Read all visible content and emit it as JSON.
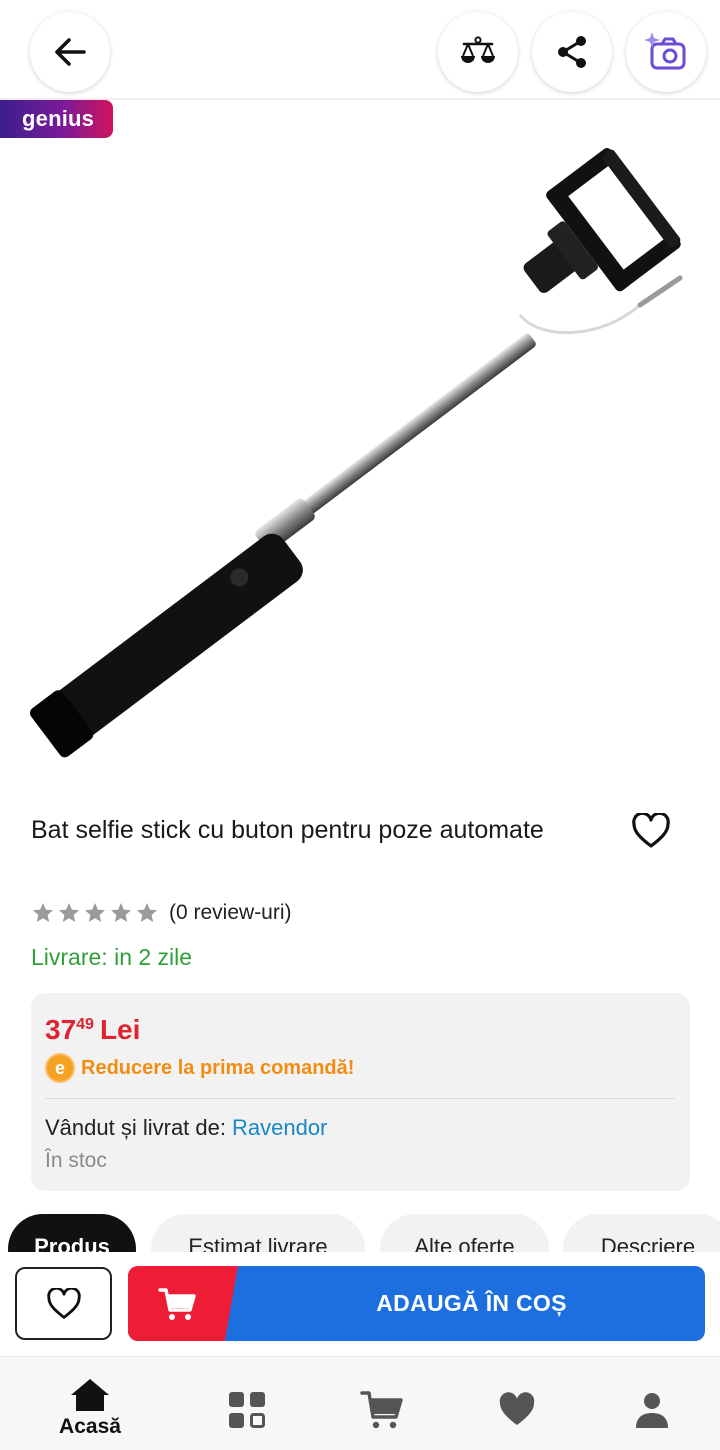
{
  "header": {
    "back_icon": "arrow-left-icon",
    "compare_icon": "scale-icon",
    "share_icon": "share-icon",
    "visual_search_icon": "camera-sparkle-icon"
  },
  "badge": {
    "label": "genius"
  },
  "product": {
    "title": "Bat selfie stick cu buton pentru poze automate",
    "rating": 0,
    "review_count_label": "(0 review-uri)",
    "delivery_label": "Livrare: in 2 zile"
  },
  "price": {
    "integer": "37",
    "decimal": "49",
    "currency": "Lei",
    "promo_icon_letter": "e",
    "promo_label": "Reducere la prima comandă!",
    "seller_prefix": "Vândut și livrat de:",
    "seller_name": "Ravendor",
    "stock_label": "În stoc"
  },
  "tabs": [
    {
      "label": "Produs",
      "active": true
    },
    {
      "label": "Estimat livrare",
      "active": false
    },
    {
      "label": "Alte oferte",
      "active": false
    },
    {
      "label": "Descriere",
      "active": false
    }
  ],
  "actions": {
    "add_to_cart_label": "ADAUGĂ ÎN COȘ",
    "wishlist_icon": "heart-outline-icon",
    "cart_icon": "cart-icon"
  },
  "nav": [
    {
      "label": "Acasă",
      "icon": "home-icon",
      "active": true
    },
    {
      "label": "",
      "icon": "categories-icon",
      "active": false
    },
    {
      "label": "",
      "icon": "cart-icon",
      "active": false
    },
    {
      "label": "",
      "icon": "heart-icon",
      "active": false
    },
    {
      "label": "",
      "icon": "account-icon",
      "active": false
    }
  ],
  "colors": {
    "price": "#e02330",
    "delivery": "#2fa13a",
    "promo": "#f08d12",
    "seller_link": "#1a86c8",
    "cart_button": "#1d6fe0",
    "cart_icon_bg": "#ee1d35"
  }
}
